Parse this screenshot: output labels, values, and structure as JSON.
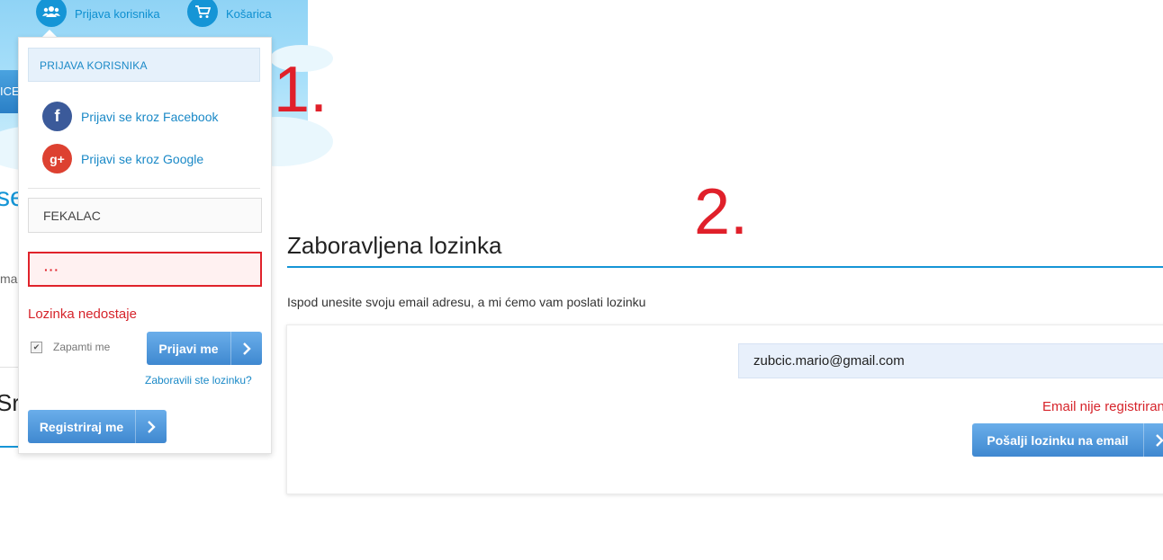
{
  "header": {
    "user_login_label": "Prijava korisnika",
    "cart_label": "Košarica",
    "nav_fragment": "ICE",
    "heading_fragment": "se",
    "text_fragment": "ma",
    "heading_fragment_2": "Sr"
  },
  "login_dropdown": {
    "title": "PRIJAVA KORISNIKA",
    "facebook_label": "Prijavi se kroz Facebook",
    "google_label": "Prijavi se kroz Google",
    "username_value": "FEKALAC",
    "password_value": "···",
    "error_text": "Lozinka nedostaje",
    "remember_label": "Zapamti me",
    "remember_checked": true,
    "login_button": "Prijavi me",
    "forgot_link": "Zaboravili ste lozinku?",
    "register_button": "Registriraj me"
  },
  "forgot_password": {
    "title": "Zaboravljena lozinka",
    "instruction": "Ispod unesite svoju email adresu, a mi ćemo vam poslati lozinku",
    "email_value": "zubcic.mario@gmail.com",
    "error_text": "Email nije registriran",
    "send_button": "Pošalji lozinku na email"
  },
  "annotations": {
    "label_1": "1.",
    "label_2": "2."
  },
  "colors": {
    "accent": "#1595d6",
    "error": "#e0232b",
    "facebook": "#3b5a9a",
    "google": "#dd4131",
    "button": "#4a90d6"
  },
  "icons": {
    "user_login": "users-icon",
    "cart": "cart-icon",
    "facebook": "facebook-icon",
    "google": "google-plus-icon",
    "chevron": "chevron-right-icon"
  }
}
